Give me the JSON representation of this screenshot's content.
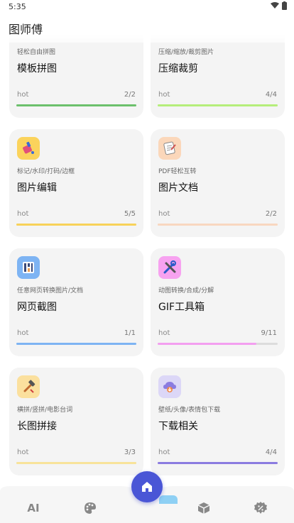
{
  "status": {
    "time": "5:35"
  },
  "app": {
    "title": "图师傅"
  },
  "cards": [
    {
      "sub": "轻松自由拼图",
      "title": "模板拼图",
      "hot": "hot",
      "count": "2/2",
      "icon": "collage-icon",
      "bar_color": "#6cc06c",
      "progress": 1.0,
      "icon_bg": ""
    },
    {
      "sub": "压缩/缩放/裁剪图片",
      "title": "压缩裁剪",
      "hot": "hot",
      "count": "4/4",
      "icon": "compress-icon",
      "bar_color": "#b5ee7a",
      "progress": 1.0,
      "icon_bg": ""
    },
    {
      "sub": "标记/水印/打码/边框",
      "title": "图片编辑",
      "hot": "hot",
      "count": "5/5",
      "icon": "paint-bucket-icon",
      "bar_color": "#f8d25a",
      "progress": 1.0,
      "icon_bg": "#fbd35c"
    },
    {
      "sub": "PDF轻松互转",
      "title": "图片文档",
      "hot": "hot",
      "count": "2/2",
      "icon": "document-icon",
      "bar_color": "#f9d7c0",
      "progress": 1.0,
      "icon_bg": "#fbd7ba"
    },
    {
      "sub": "任意网页转换图片/文档",
      "title": "网页截图",
      "hot": "hot",
      "count": "1/1",
      "icon": "webpage-icon",
      "bar_color": "#7eb4f3",
      "progress": 1.0,
      "icon_bg": "#7eb4f3"
    },
    {
      "sub": "动图转换/合成/分解",
      "title": "GIF工具箱",
      "hot": "hot",
      "count": "9/11",
      "icon": "tools-icon",
      "bar_color": "#f39ff0",
      "progress": 0.818,
      "icon_bg": "#f7a2f0"
    },
    {
      "sub": "横拼/竖拼/电影台词",
      "title": "长图拼接",
      "hot": "hot",
      "count": "3/3",
      "icon": "hammer-icon",
      "bar_color": "#f8e39a",
      "progress": 1.0,
      "icon_bg": "#fbe09e"
    },
    {
      "sub": "壁纸/头像/表情包下载",
      "title": "下载相关",
      "hot": "hot",
      "count": "4/4",
      "icon": "cloud-download-icon",
      "bar_color": "#8b7be0",
      "progress": 1.0,
      "icon_bg": "#dcd7f7"
    }
  ],
  "nav": {
    "ai_label": "AI",
    "items": [
      "ai-icon",
      "palette-icon",
      "home-icon",
      "box-icon",
      "settings-icon"
    ]
  }
}
